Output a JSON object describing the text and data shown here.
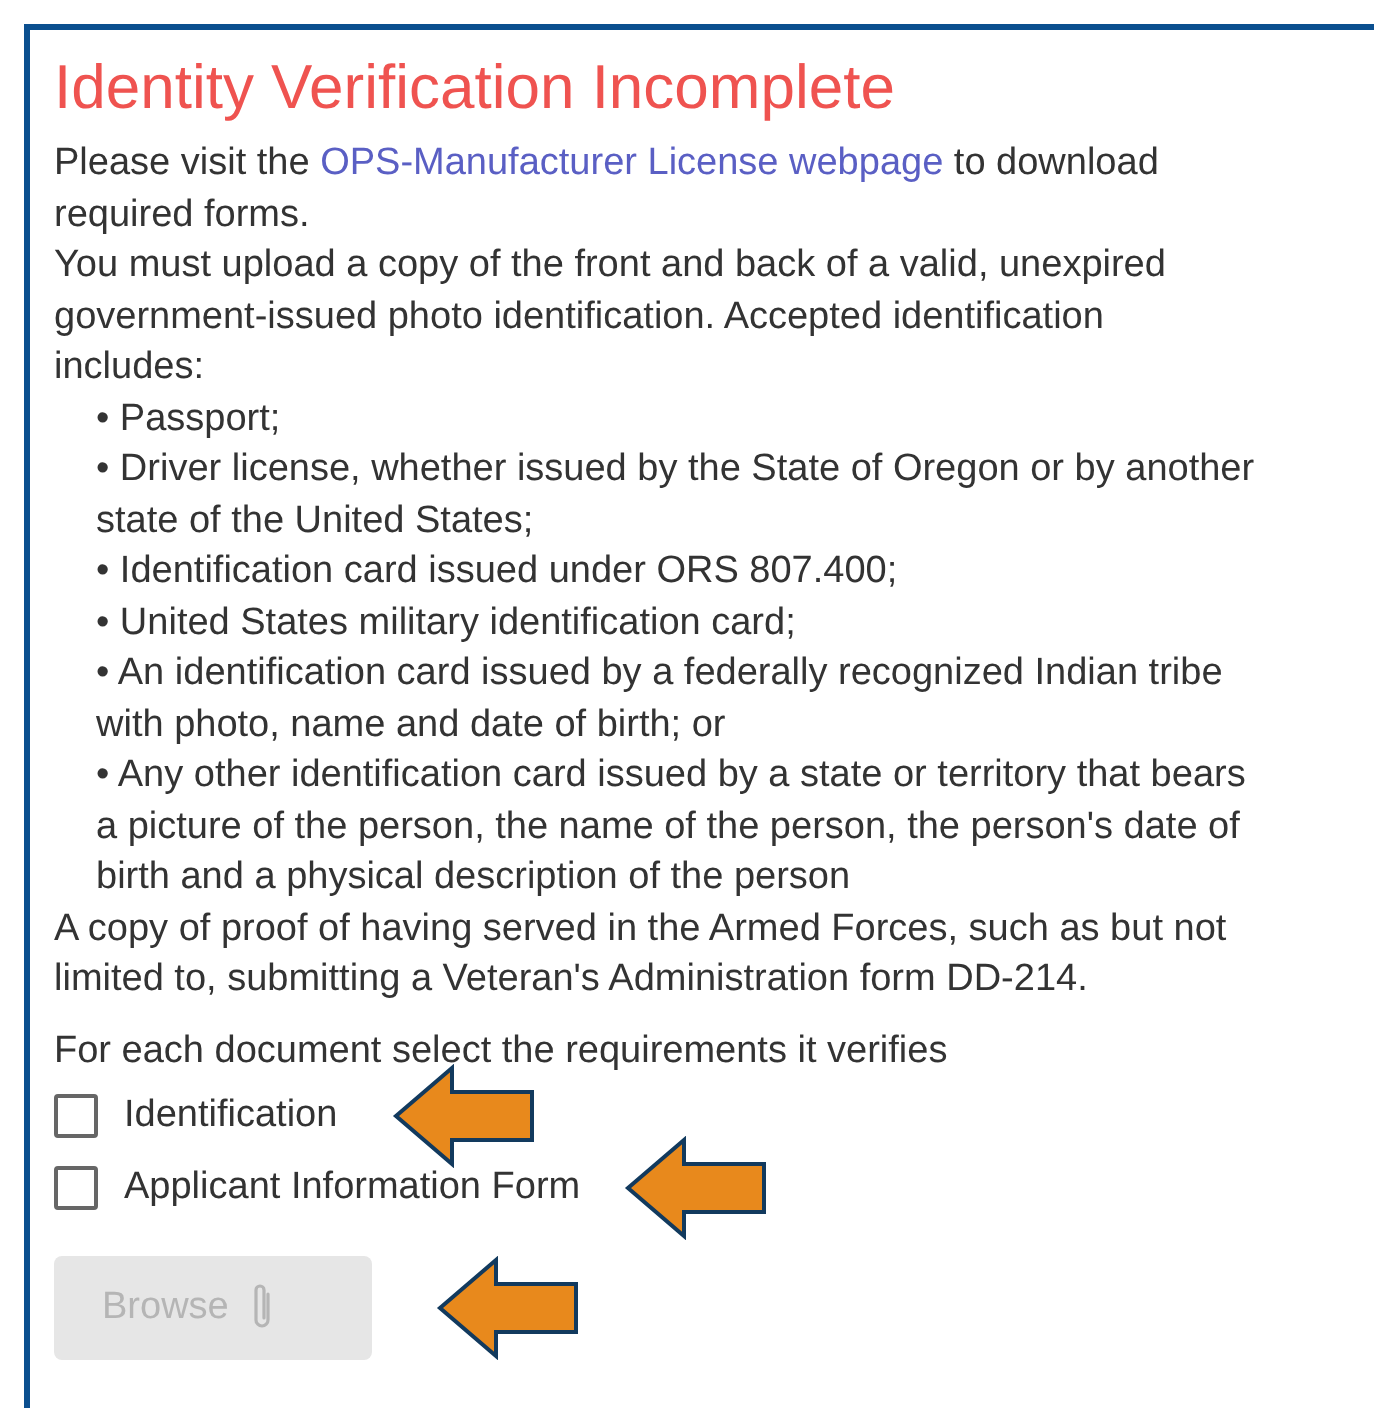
{
  "title": "Identity Verification Incomplete",
  "intro": {
    "before": "Please visit the ",
    "link": "OPS-Manufacturer License webpage",
    "after": " to download required forms."
  },
  "paragraph": "You must upload a copy of the front and back of a valid, unexpired government-issued photo identification. Accepted identification includes:",
  "bullets": [
    "• Passport;",
    "• Driver license, whether issued by the State of Oregon or by another state of the United States;",
    "• Identification card issued under ORS 807.400;",
    "• United States military identification card;",
    "• An identification card issued by a federally recognized Indian tribe with photo, name and date of birth; or",
    "• Any other identification card issued by a state or territory that bears a picture of the person, the name of the person, the person's date of birth and a physical description of the person"
  ],
  "note": "A copy of proof of having served in the Armed Forces, such as but not limited to, submitting a Veteran's Administration form DD-214.",
  "prompt": "For each document select the requirements it verifies",
  "checkboxes": [
    {
      "label": "Identification",
      "checked": false
    },
    {
      "label": "Applicant Information Form",
      "checked": false
    }
  ],
  "browse_button": {
    "label": "Browse",
    "disabled": true
  }
}
